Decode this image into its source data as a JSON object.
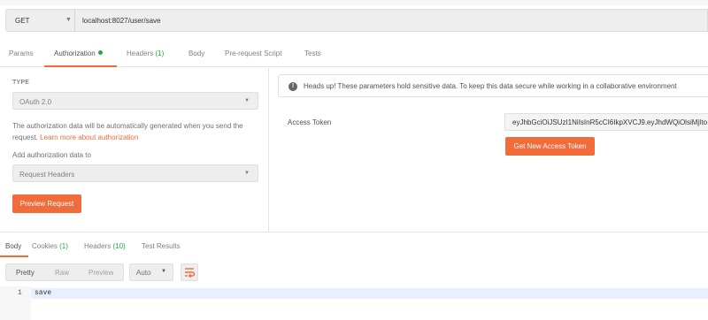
{
  "request": {
    "method": "GET",
    "url": "localhost:8027/user/save"
  },
  "request_tabs": [
    {
      "label": "Params",
      "count": ""
    },
    {
      "label": "Authorization",
      "count": ""
    },
    {
      "label": "Headers",
      "count": "(1)"
    },
    {
      "label": "Body",
      "count": ""
    },
    {
      "label": "Pre-request Script",
      "count": ""
    },
    {
      "label": "Tests",
      "count": ""
    }
  ],
  "auth": {
    "type_label": "TYPE",
    "type_value": "OAuth 2.0",
    "info_text": "The authorization data will be automatically generated when you send the request.",
    "learn_more": "Learn more about authorization",
    "add_to_label": "Add authorization data to",
    "add_to_value": "Request Headers",
    "preview_button": "Preview Request"
  },
  "notice": {
    "text": "Heads up! These parameters hold sensitive data. To keep this data secure while working in a collaborative environment"
  },
  "token": {
    "label": "Access Token",
    "value": "eyJhbGciOiJSUzI1NiIsInR5cCI6IkpXVCJ9.eyJhdWQiOlsiMjIto",
    "get_new_button": "Get New Access Token"
  },
  "response_tabs": [
    {
      "label": "Body",
      "count": ""
    },
    {
      "label": "Cookies",
      "count": "(1)"
    },
    {
      "label": "Headers",
      "count": "(10)"
    },
    {
      "label": "Test Results",
      "count": ""
    }
  ],
  "response_view": {
    "modes": [
      "Pretty",
      "Raw",
      "Preview"
    ],
    "format": "Auto"
  },
  "editor": {
    "line_number": "1",
    "content": "save"
  },
  "colors": {
    "accent": "#f26b3a",
    "count_green": "#28a745"
  }
}
